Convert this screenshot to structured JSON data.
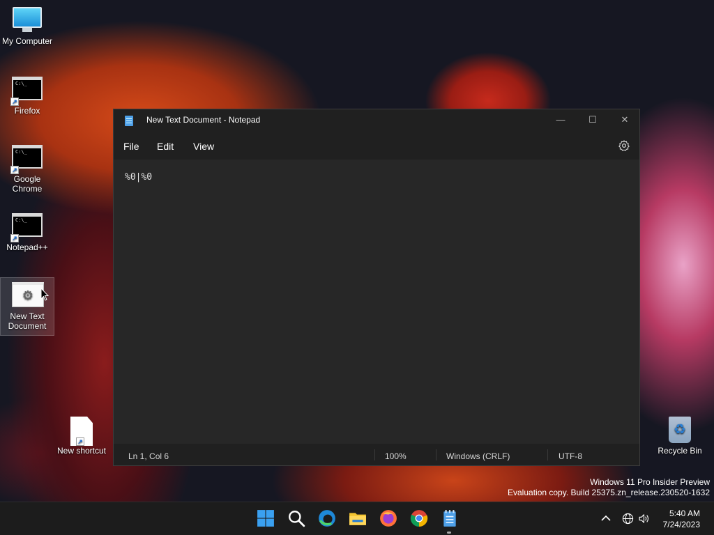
{
  "desktop": {
    "icons": [
      {
        "label": "My Computer"
      },
      {
        "label": "Firefox"
      },
      {
        "label": "Google Chrome"
      },
      {
        "label": "Notepad++"
      },
      {
        "label": "New Text Document"
      },
      {
        "label": "New shortcut"
      },
      {
        "label": "Recycle Bin"
      }
    ],
    "cmd_glyph": "C:\\_"
  },
  "window": {
    "title": "New Text Document - Notepad",
    "controls": {
      "minimize": "—",
      "maximize": "☐",
      "close": "✕"
    },
    "menu": [
      "File",
      "Edit",
      "View"
    ],
    "editor_text": "%0|%0",
    "status": {
      "position": "Ln 1, Col 6",
      "zoom": "100%",
      "line_ending": "Windows (CRLF)",
      "encoding": "UTF-8"
    }
  },
  "watermark": {
    "line1": "Windows 11 Pro Insider Preview",
    "line2": "Evaluation copy. Build 25375.zn_release.230520-1632"
  },
  "taskbar": {
    "apps": [
      "start-icon",
      "search-icon",
      "edge-icon",
      "file-explorer-icon",
      "firefox-icon",
      "chrome-icon",
      "notepad-icon"
    ],
    "time": "5:40 AM",
    "date": "7/24/2023"
  }
}
